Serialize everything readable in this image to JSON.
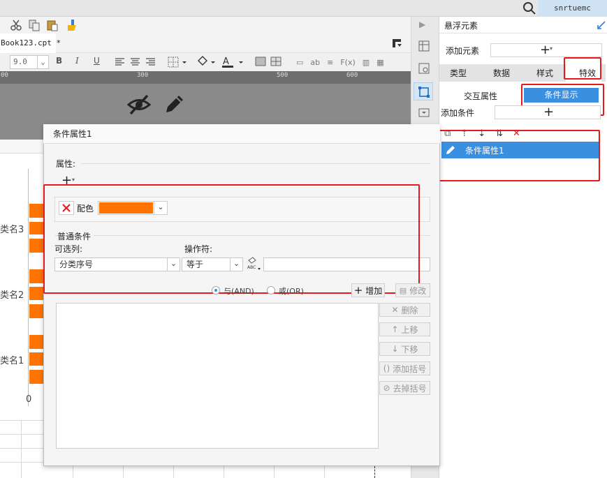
{
  "topbar": {
    "user": "snrtuemc"
  },
  "file_tab": {
    "name": "Book123.cpt *"
  },
  "format": {
    "font_size": "9.0"
  },
  "ruler": {
    "ticks": [
      "00",
      "100",
      "200",
      "300",
      "400",
      "500",
      "600"
    ]
  },
  "chart": {
    "categories": [
      "类名3",
      "类名2",
      "类名1"
    ],
    "zero": "0"
  },
  "right_panel": {
    "title": "悬浮元素",
    "add_element_label": "添加元素",
    "tabs": [
      "类型",
      "数据",
      "样式",
      "特效"
    ],
    "subtabs": [
      "交互属性",
      "条件显示"
    ],
    "add_condition_label": "添加条件",
    "condition_item": "条件属性1"
  },
  "dialog": {
    "title": "条件属性1",
    "attr_label": "属性:",
    "color_label": "配色",
    "color_value": "#ff7300",
    "general_label": "普通条件",
    "column_label": "可选列:",
    "operator_label": "操作符:",
    "column_value": "分类序号",
    "operator_value": "等于",
    "and_label": "与(AND)",
    "or_label": "或(OR)",
    "add_btn": "增加",
    "modify_btn": "修改",
    "delete_btn": "删除",
    "up_btn": "上移",
    "down_btn": "下移",
    "add_bracket_btn": "添加括号",
    "remove_bracket_btn": "去掉括号"
  }
}
